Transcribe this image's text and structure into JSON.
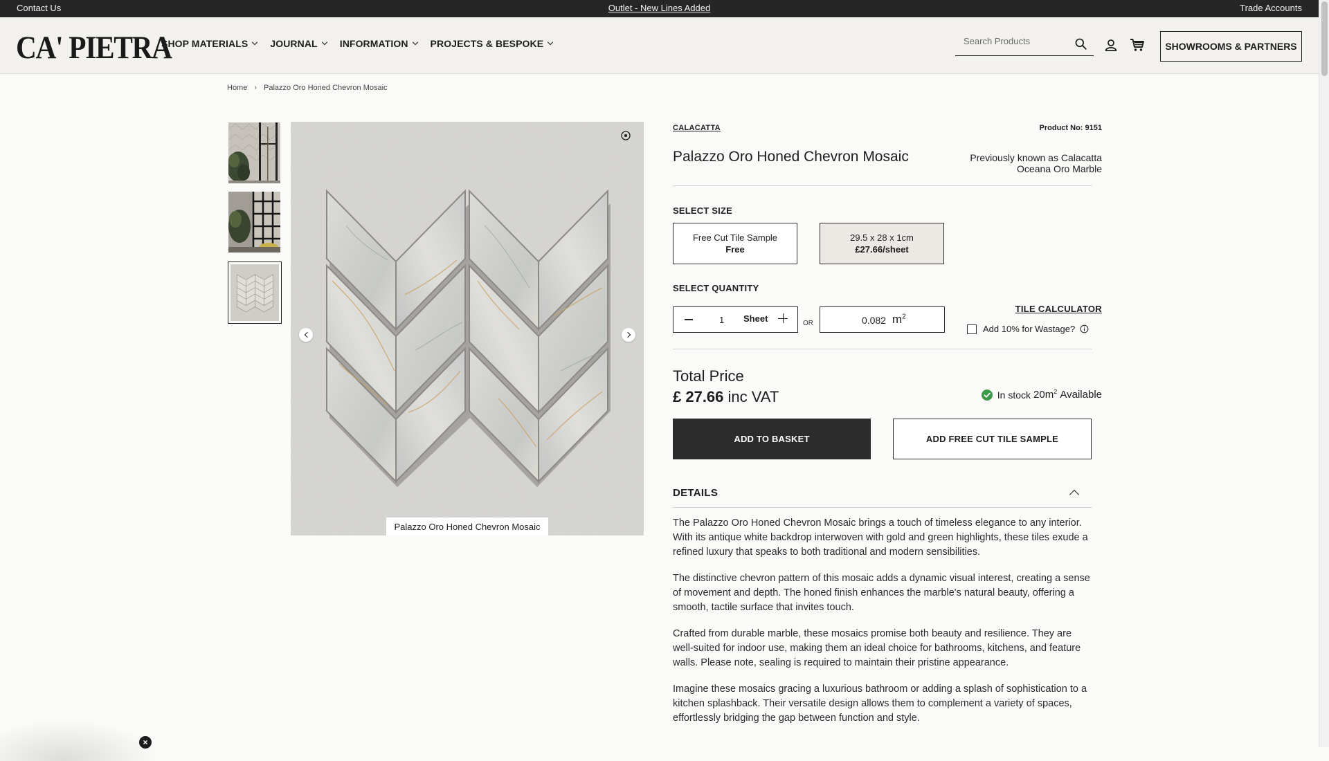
{
  "topbar": {
    "contact": "Contact Us",
    "promo": "Outlet - New Lines Added",
    "trade": "Trade Accounts"
  },
  "header": {
    "logo": "CA' PIETRA",
    "nav": [
      "SHOP MATERIALS",
      "JOURNAL",
      "INFORMATION",
      "PROJECTS & BESPOKE"
    ],
    "search_placeholder": "Search Products",
    "showrooms": "SHOWROOMS & PARTNERS"
  },
  "breadcrumb": {
    "home": "Home",
    "current": "Palazzo Oro Honed Chevron Mosaic"
  },
  "gallery": {
    "caption": "Palazzo Oro Honed Chevron Mosaic",
    "selected_index": 3,
    "thumb_count": 3
  },
  "product": {
    "brand": "CALACATTA",
    "product_no": "Product No: 9151",
    "title": "Palazzo Oro Honed Chevron Mosaic",
    "previously_known": "Previously known as Calacatta Oceana Oro Marble",
    "select_size_label": "SELECT SIZE",
    "sizes": [
      {
        "line1": "Free Cut Tile Sample",
        "line2": "Free",
        "selected": false
      },
      {
        "line1": "29.5 x 28 x 1cm",
        "line2": "£27.66/sheet",
        "selected": true
      }
    ],
    "select_quantity_label": "SELECT QUANTITY",
    "quantity": "1",
    "quantity_unit": "Sheet",
    "or": "OR",
    "area_value": "0.082",
    "area_unit": "m",
    "area_exp": "2",
    "tile_calculator": "TILE CALCULATOR",
    "wastage_label": "Add 10% for Wastage?",
    "total_label": "Total Price",
    "price_amount": "£ 27.66",
    "price_suffix": "inc VAT",
    "stock_prefix": "In stock",
    "stock_amount": "20m",
    "stock_exp": "2",
    "stock_suffix": "Available",
    "add_to_basket": "ADD TO BASKET",
    "add_sample": "ADD FREE CUT TILE SAMPLE",
    "details_label": "DETAILS",
    "description": [
      "The Palazzo Oro Honed Chevron Mosaic brings a touch of timeless elegance to any interior. With its antique white backdrop interwoven with gold and green highlights, these tiles exude a refined luxury that speaks to both traditional and modern sensibilities.",
      "The distinctive chevron pattern of this mosaic adds a dynamic visual interest, creating a sense of movement and depth. The honed finish enhances the marble's natural beauty, offering a smooth, tactile surface that invites touch.",
      "Crafted from durable marble, these mosaics promise both beauty and resilience. They are well-suited for indoor use, making them an ideal choice for bathrooms, kitchens, and feature walls. Please note, sealing is required to maintain their pristine appearance.",
      "Imagine these mosaics gracing a luxurious bathroom or adding a splash of sophistication to a kitchen splashback. Their versatile design allows them to complement a variety of spaces, effortlessly bridging the gap between function and style."
    ]
  },
  "icons": {
    "search": "search-icon",
    "account": "account-icon",
    "cart": "cart-icon",
    "zoom": "zoom-icon",
    "info": "info-icon",
    "stock": "check-circle-icon"
  },
  "colors": {
    "header_bg": "#f3f1ee",
    "topbar_bg": "#262626",
    "basket_bg": "#2c2c2c",
    "stock_green": "#3a9a45"
  }
}
